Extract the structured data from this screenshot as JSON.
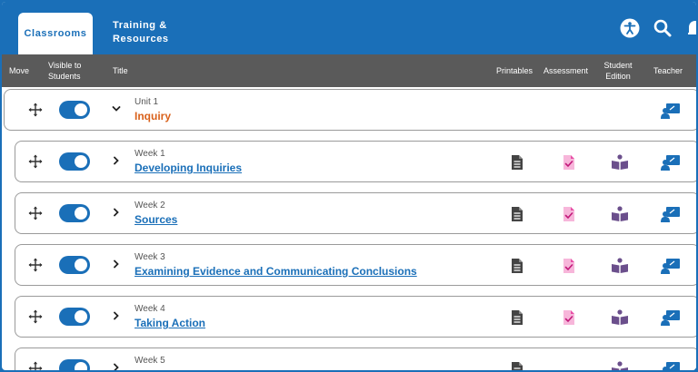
{
  "nav": {
    "tabs": [
      "Classrooms",
      "Training & Resources"
    ],
    "accessibility_icon": "accessibility-icon",
    "search_icon": "search-icon",
    "bell_icon": "bell-icon"
  },
  "header": {
    "move": "Move",
    "visible": "Visible to Students",
    "title": "Title",
    "printables": "Printables",
    "assessment": "Assessment",
    "student_edition": "Student Edition",
    "teacher": "Teacher"
  },
  "unit": {
    "label": "Unit 1",
    "title": "Inquiry"
  },
  "weeks": [
    {
      "label": "Week 1",
      "title": "Developing Inquiries"
    },
    {
      "label": "Week 2",
      "title": "Sources"
    },
    {
      "label": "Week 3",
      "title": "Examining Evidence and Communicating Conclusions"
    },
    {
      "label": "Week 4",
      "title": "Taking Action"
    },
    {
      "label": "Week 5",
      "title": ""
    }
  ],
  "colors": {
    "brand": "#1a6fb8",
    "unit_title": "#d9611b",
    "assessment": "#e84fa6",
    "student_edition": "#6b4f8c"
  }
}
